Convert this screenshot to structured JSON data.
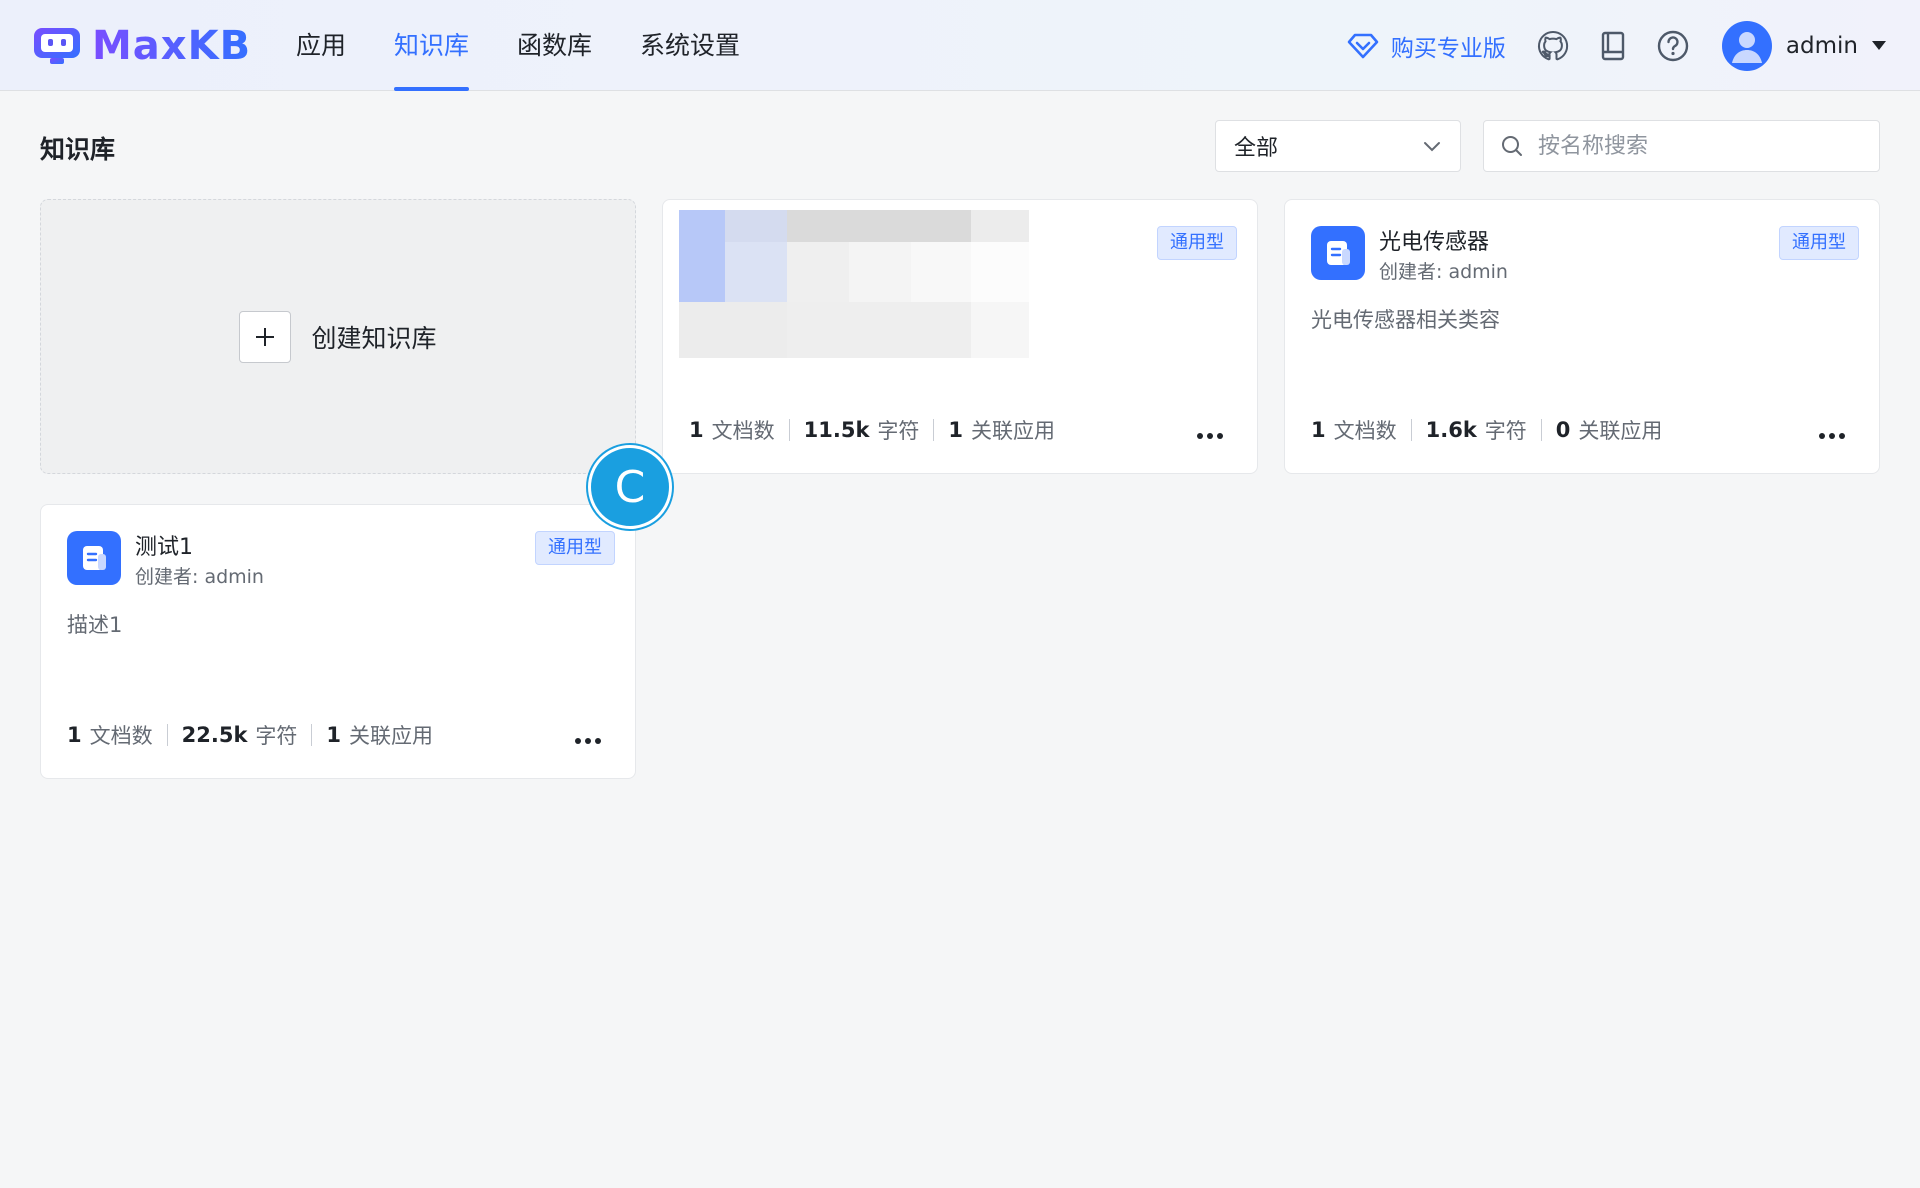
{
  "header": {
    "brand": "MaxKB",
    "nav": [
      {
        "label": "应用"
      },
      {
        "label": "知识库"
      },
      {
        "label": "函数库"
      },
      {
        "label": "系统设置"
      }
    ],
    "active_nav": 1,
    "pro_label": "购买专业版",
    "user": "admin"
  },
  "page": {
    "title": "知识库",
    "filter_value": "全部",
    "search_placeholder": "按名称搜索"
  },
  "create_card": {
    "label": "创建知识库"
  },
  "cards": [
    {
      "name": "",
      "creator": "",
      "tag": "通用型",
      "desc": "",
      "docs": "1",
      "docs_label": "文档数",
      "chars": "11.5k",
      "chars_label": "字符",
      "apps": "1",
      "apps_label": "关联应用"
    },
    {
      "name": "光电传感器",
      "creator": "创建者: admin",
      "tag": "通用型",
      "desc": "光电传感器相关类容",
      "docs": "1",
      "docs_label": "文档数",
      "chars": "1.6k",
      "chars_label": "字符",
      "apps": "0",
      "apps_label": "关联应用"
    },
    {
      "name": "测试1",
      "creator": "创建者: admin",
      "tag": "通用型",
      "desc": "描述1",
      "docs": "1",
      "docs_label": "文档数",
      "chars": "22.5k",
      "chars_label": "字符",
      "apps": "1",
      "apps_label": "关联应用"
    }
  ],
  "loader_letter": "C",
  "colors": {
    "accent": "#3370ff",
    "loader": "#1a9fe0"
  }
}
